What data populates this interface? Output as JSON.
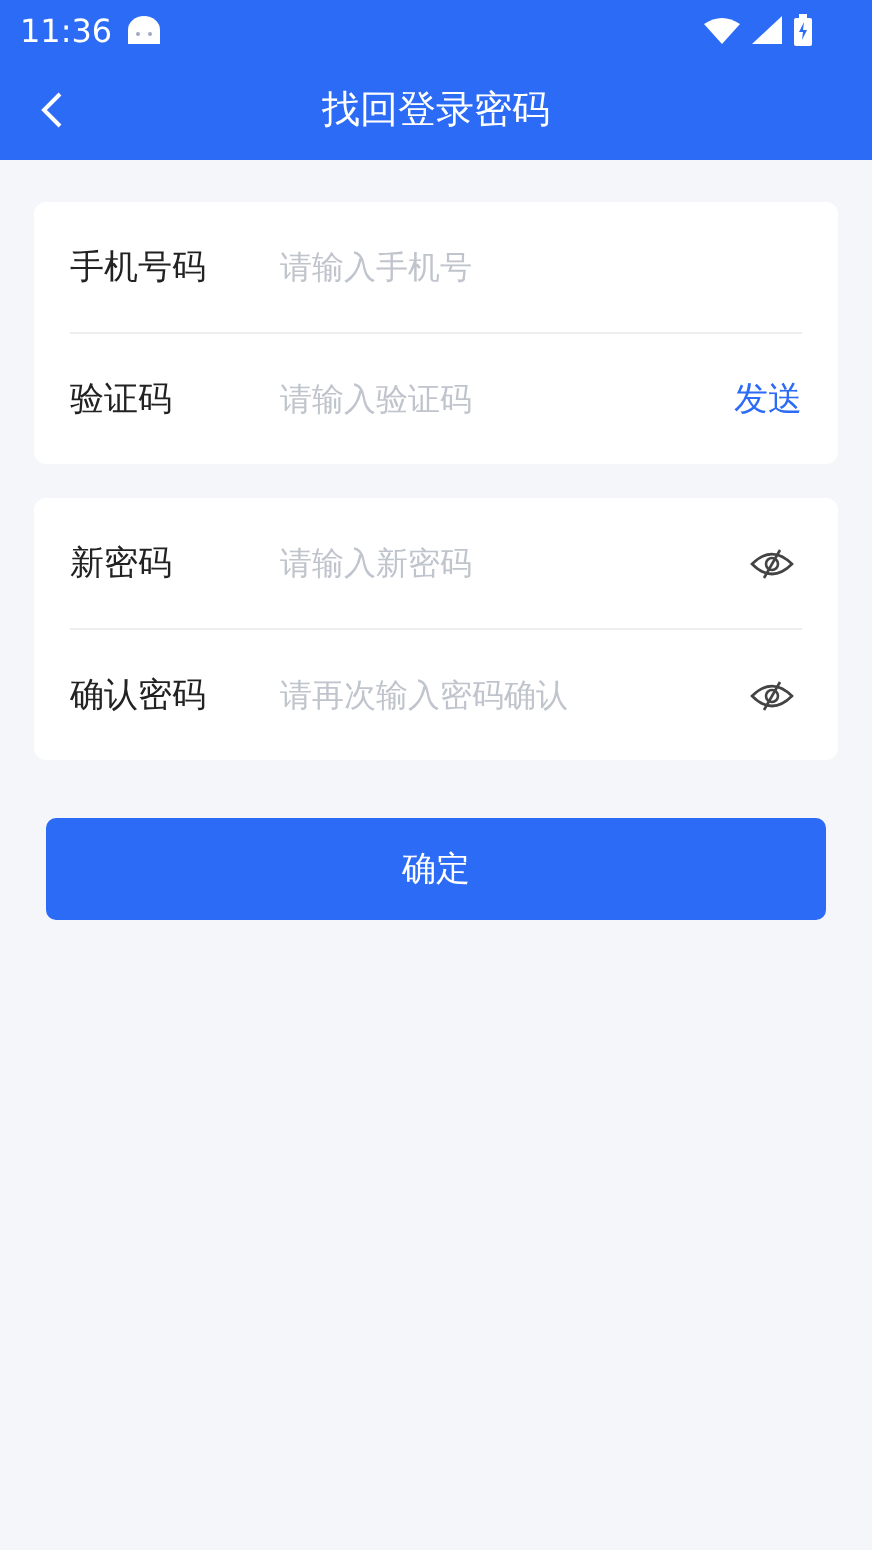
{
  "status_bar": {
    "time": "11:36"
  },
  "header": {
    "title": "找回登录密码"
  },
  "groups": [
    {
      "rows": [
        {
          "label": "手机号码",
          "placeholder": "请输入手机号"
        },
        {
          "label": "验证码",
          "placeholder": "请输入验证码",
          "action": {
            "kind": "link",
            "text": "发送"
          }
        }
      ]
    },
    {
      "rows": [
        {
          "label": "新密码",
          "placeholder": "请输入新密码",
          "action": {
            "kind": "eye"
          }
        },
        {
          "label": "确认密码",
          "placeholder": "请再次输入密码确认",
          "action": {
            "kind": "eye"
          }
        }
      ]
    }
  ],
  "submit": "确定"
}
